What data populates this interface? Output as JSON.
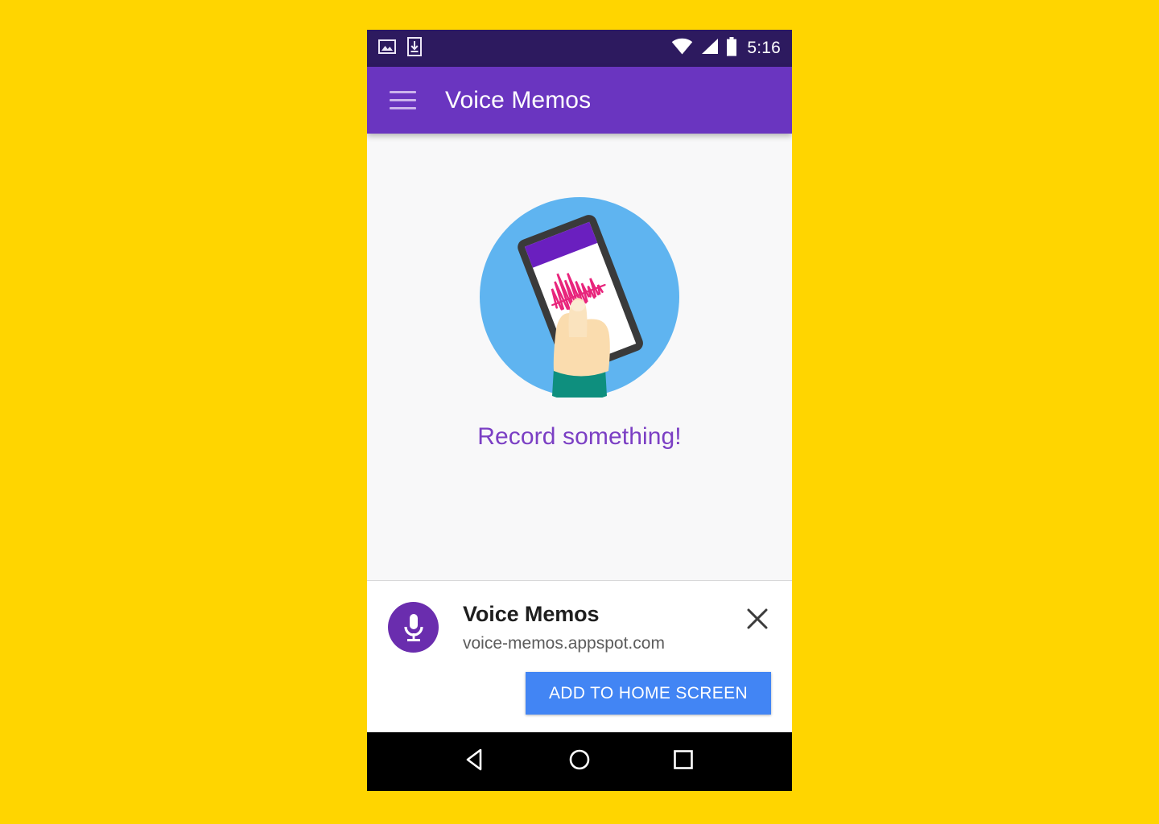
{
  "page": {
    "background_color": "#FFD500"
  },
  "device": {
    "status_bar": {
      "background_color": "#2D1A5F",
      "time": "5:16",
      "left_icons": [
        "image-icon",
        "download-icon"
      ],
      "right_icons": [
        "wifi-icon",
        "cellular-signal-icon",
        "battery-icon"
      ]
    },
    "app_bar": {
      "background_color": "#6A35C0",
      "menu_label": "Menu",
      "title": "Voice Memos"
    },
    "content": {
      "background_color": "#F8F8F9",
      "illustration_name": "hand-holding-phone-recording-illustration",
      "illustration_colors": {
        "circle": "#5FB4F0",
        "phone_frame": "#3A3A3A",
        "phone_header": "#6A1FBF",
        "phone_screen": "#FFFFFF",
        "waveform": "#E8257C",
        "skin": "#FADCAE",
        "sleeve": "#0E8F7E"
      },
      "empty_state_text": "Record something!",
      "empty_state_text_color": "#7B3FC4"
    },
    "install_banner": {
      "app_icon_name": "microphone-icon",
      "app_icon_background": "#6A2DAE",
      "app_name": "Voice Memos",
      "origin": "voice-memos.appspot.com",
      "close_label": "Close",
      "install_button_label": "ADD TO HOME SCREEN",
      "install_button_color": "#4285F4"
    },
    "nav_bar": {
      "background_color": "#000000",
      "buttons": [
        {
          "name": "back-button",
          "icon": "triangle-back-icon"
        },
        {
          "name": "home-button",
          "icon": "circle-home-icon"
        },
        {
          "name": "recents-button",
          "icon": "square-recents-icon"
        }
      ]
    }
  }
}
